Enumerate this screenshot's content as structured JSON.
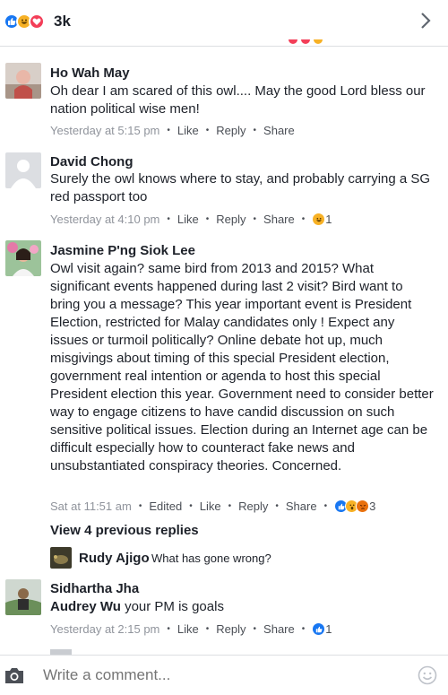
{
  "header": {
    "reaction_count": "3k",
    "reactions": [
      "like",
      "haha",
      "love"
    ]
  },
  "comments": [
    {
      "author": "Ho Wah May",
      "text": "Oh dear I am scared of this owl.... May the good Lord bless our nation political wise men!",
      "time": "Yesterday at 5:15 pm",
      "like": "Like",
      "reply": "Reply",
      "share": "Share"
    },
    {
      "author": "David Chong",
      "text": "Surely the owl knows where to stay, and probably carrying a SG red passport too",
      "time": "Yesterday at 4:10 pm",
      "like": "Like",
      "reply": "Reply",
      "share": "Share",
      "reaction_count": "1"
    },
    {
      "author": "Jasmine P'ng Siok Lee",
      "text": "Owl visit again? same bird from 2013 and 2015?  What significant events happened during last 2 visit?  Bird want to bring you a message? This year important event is President Election, restricted for Malay candidates only ! Expect any issues or turmoil politically? Online debate hot up,  much misgivings about timing of this special President election,  government real intention or agenda to host this special President election this year. Government need to consider better way to engage citizens to have candid discussion on such sensitive political issues. Election during an Internet age can be difficult especially how to counteract fake news and unsubstantiated conspiracy theories. Concerned.",
      "time": "Sat at 11:51 am",
      "edited": "Edited",
      "like": "Like",
      "reply": "Reply",
      "share": "Share",
      "reaction_count": "3",
      "view_previous": "View 4 previous replies",
      "reply_preview": {
        "author": "Rudy Ajigo",
        "text": "What has gone wrong?"
      }
    },
    {
      "author": "Sidhartha Jha",
      "mention": "Audrey Wu",
      "text": " your PM is goals",
      "time": "Yesterday at 2:15 pm",
      "like": "Like",
      "reply": "Reply",
      "share": "Share",
      "reaction_count": "1"
    }
  ],
  "composer": {
    "placeholder": "Write a comment..."
  },
  "colors": {
    "like_blue": "#1877f2",
    "meta_grey": "#90949c",
    "text": "#1d2129"
  }
}
